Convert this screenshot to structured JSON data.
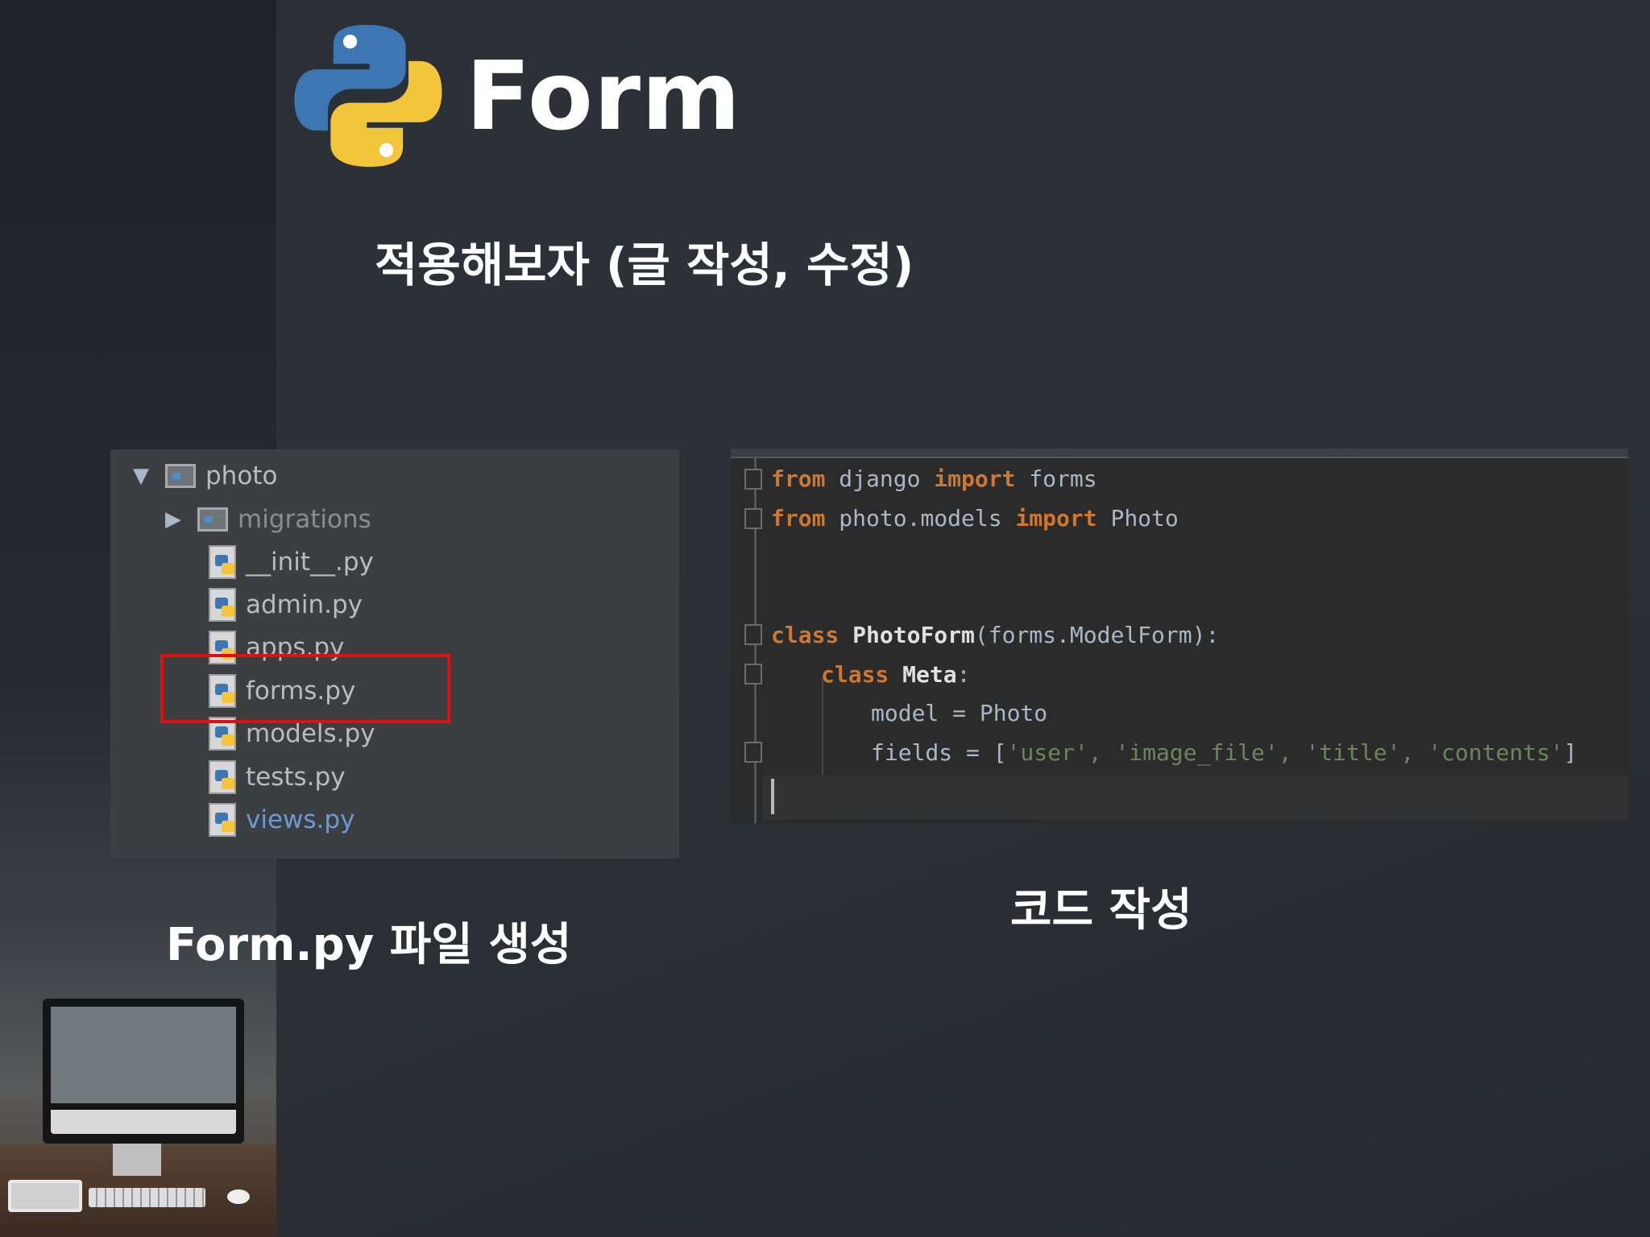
{
  "slide": {
    "title": "Form",
    "subtitle": "적용해보자 (글 작성, 수정)",
    "caption_left": "Form.py 파일 생성",
    "caption_right": "코드 작성"
  },
  "file_tree": {
    "items": [
      {
        "arrow": "▼",
        "name": "photo",
        "type": "folder"
      },
      {
        "arrow": "▶",
        "name": "migrations",
        "type": "folder"
      },
      {
        "name": "__init__.py",
        "type": "file"
      },
      {
        "name": "admin.py",
        "type": "file"
      },
      {
        "name": "apps.py",
        "type": "file"
      },
      {
        "name": "forms.py",
        "type": "file",
        "highlighted": true
      },
      {
        "name": "models.py",
        "type": "file"
      },
      {
        "name": "tests.py",
        "type": "file"
      },
      {
        "name": "views.py",
        "type": "file"
      }
    ]
  },
  "code": {
    "line1": {
      "kw1": "from",
      "mod": " django ",
      "kw2": "import",
      "name": " forms"
    },
    "line2": {
      "kw1": "from",
      "mod": " photo.models ",
      "kw2": "import",
      "name": " Photo"
    },
    "line3": {
      "kw": "class",
      "cls": " PhotoForm",
      "rest": "(forms.ModelForm):"
    },
    "line4": {
      "kw": "class",
      "cls": " Meta",
      "rest": ":"
    },
    "line5": {
      "text": "model = Photo"
    },
    "line6": {
      "pre": "fields = [",
      "s1": "'user'",
      "s2": "'image_file'",
      "s3": "'title'",
      "s4": "'contents'",
      "sep": ", ",
      "post": "]"
    }
  },
  "colors": {
    "keyword": "#cc7832",
    "string": "#6a8759",
    "highlight_box": "#e01010",
    "python_blue": "#3d77b3",
    "python_yellow": "#f3c53a"
  },
  "icons": [
    "python-logo-icon",
    "folder-icon",
    "python-file-icon",
    "expand-arrow-icon",
    "collapse-arrow-icon"
  ]
}
